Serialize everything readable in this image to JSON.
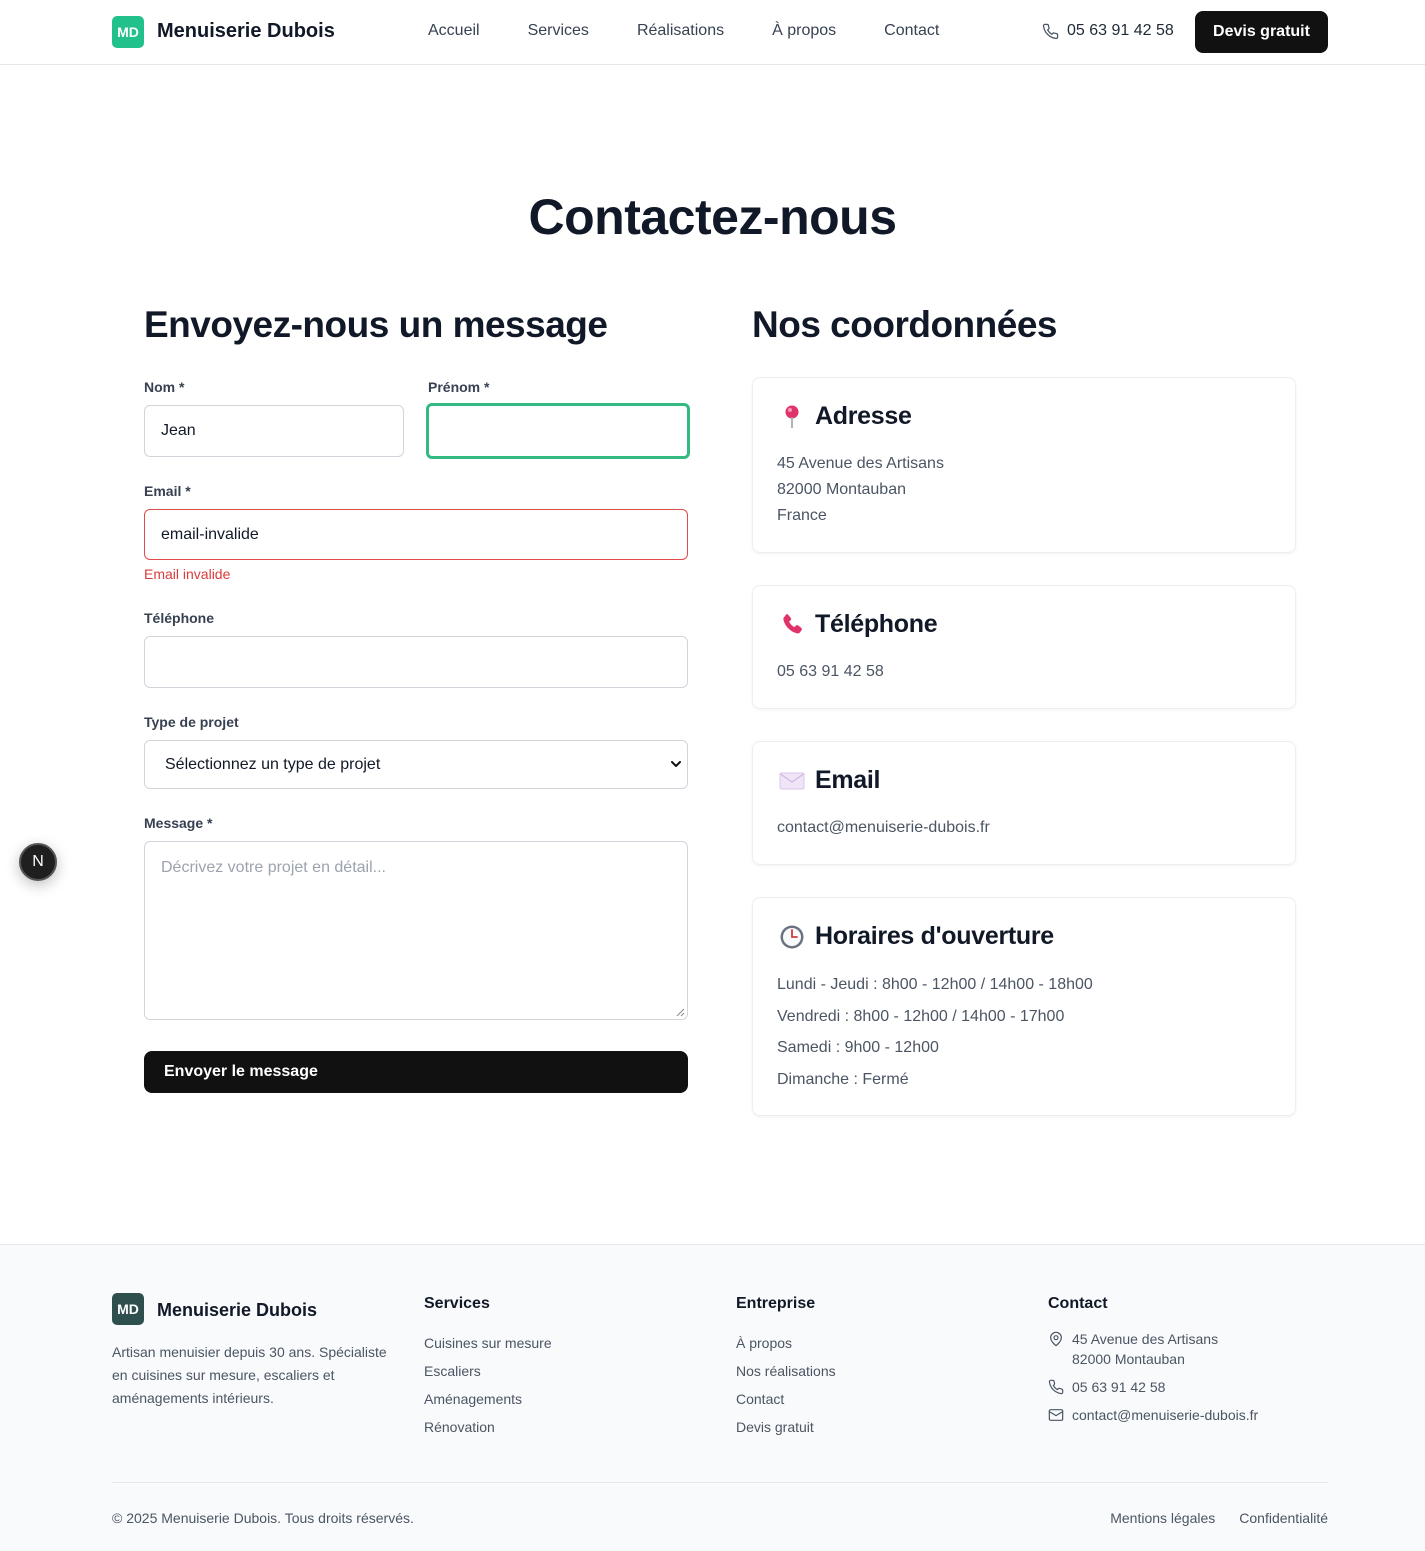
{
  "header": {
    "logo_initials": "MD",
    "brand": "Menuiserie Dubois",
    "nav": [
      "Accueil",
      "Services",
      "Réalisations",
      "À propos",
      "Contact"
    ],
    "phone": "05 63 91 42 58",
    "cta": "Devis gratuit"
  },
  "page_title": "Contactez-nous",
  "form": {
    "title": "Envoyez-nous un message",
    "nom_label": "Nom *",
    "nom_value": "Jean",
    "prenom_label": "Prénom *",
    "prenom_value": "",
    "email_label": "Email *",
    "email_value": "email-invalide",
    "email_error": "Email invalide",
    "telephone_label": "Téléphone",
    "telephone_value": "",
    "type_label": "Type de projet",
    "type_selected": "Sélectionnez un type de projet",
    "message_label": "Message *",
    "message_placeholder": "Décrivez votre projet en détail...",
    "submit": "Envoyer le message"
  },
  "coordinates": {
    "title": "Nos coordonnées",
    "address": {
      "title": "Adresse",
      "icon": "pushpin-icon",
      "lines": [
        "45 Avenue des Artisans",
        "82000 Montauban",
        "France"
      ]
    },
    "phone": {
      "title": "Téléphone",
      "icon": "telephone-receiver-icon",
      "value": "05 63 91 42 58"
    },
    "email": {
      "title": "Email",
      "icon": "envelope-icon",
      "value": "contact@menuiserie-dubois.fr"
    },
    "hours": {
      "title": "Horaires d'ouverture",
      "icon": "clock-icon",
      "lines": [
        "Lundi - Jeudi : 8h00 - 12h00 / 14h00 - 18h00",
        "Vendredi : 8h00 - 12h00 / 14h00 - 17h00",
        "Samedi : 9h00 - 12h00",
        "Dimanche : Fermé"
      ]
    }
  },
  "floating_badge": "N",
  "footer": {
    "logo_initials": "MD",
    "brand": "Menuiserie Dubois",
    "description": "Artisan menuisier depuis 30 ans. Spécialiste en cuisines sur mesure, escaliers et aménagements intérieurs.",
    "services_title": "Services",
    "services": [
      "Cuisines sur mesure",
      "Escaliers",
      "Aménagements",
      "Rénovation"
    ],
    "company_title": "Entreprise",
    "company": [
      "À propos",
      "Nos réalisations",
      "Contact",
      "Devis gratuit"
    ],
    "contact_title": "Contact",
    "contact_address_1": "45 Avenue des Artisans",
    "contact_address_2": "82000 Montauban",
    "contact_phone": "05 63 91 42 58",
    "contact_email": "contact@menuiserie-dubois.fr",
    "copyright": "© 2025 Menuiserie Dubois. Tous droits réservés.",
    "legal": [
      "Mentions légales",
      "Confidentialité"
    ]
  },
  "colors": {
    "brand_green": "#22c08a",
    "focus_green": "#34b983",
    "error_red": "#dc3b3b",
    "dark_button": "#111111"
  }
}
